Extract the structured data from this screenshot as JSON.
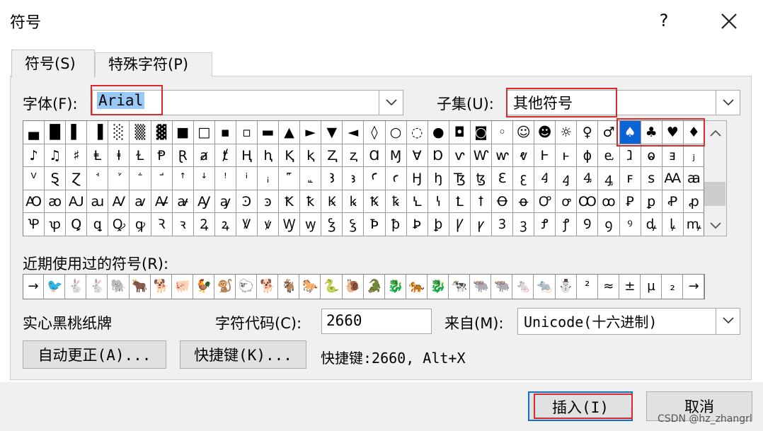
{
  "window": {
    "title": "符号",
    "help_glyph": "?"
  },
  "tabs": [
    {
      "label": "符号(S)"
    },
    {
      "label": "特殊字符(P)"
    }
  ],
  "font": {
    "label": "字体(F):",
    "value": "Arial"
  },
  "subset": {
    "label": "子集(U):",
    "value": "其他符号"
  },
  "grid_rows": [
    [
      "▄",
      "█",
      "▌",
      "▐",
      "░",
      "▒",
      "▓",
      "■",
      "□",
      "▪",
      "▫",
      "▬",
      "▲",
      "►",
      "▼",
      "◄",
      "◊",
      "○",
      "◌",
      "●",
      "◘",
      "◙",
      "◦",
      "☺",
      "☻",
      "☼",
      "♀",
      "♂",
      "♠",
      "♣",
      "♥",
      "♦"
    ],
    [
      "♪",
      "♫",
      "♯",
      "Ⱡ",
      "ⱡ",
      "Ɫ",
      "Ᵽ",
      "Ɽ",
      "ⱥ",
      "ⱦ",
      "Ⱨ",
      "ⱨ",
      "Ⱪ",
      "ⱪ",
      "Ⱬ",
      "ⱬ",
      "Ɑ",
      "Ɱ",
      "Ɐ",
      "Ɒ",
      "ⱱ",
      "Ⱳ",
      "ⱳ",
      "ⱴ",
      "Ⱶ",
      "ⱶ",
      "ɸ",
      "ⱸ",
      "ⱹ",
      "ⱺ",
      "ⱻ",
      "ⱼ"
    ],
    [
      "ⱽ",
      "Ȿ",
      "Ɀ",
      "ꜗ",
      "ꜘ",
      "ꜙ",
      "ꜚ",
      "ꜛ",
      "ꜜ",
      "ꜝ",
      "ꜞ",
      "ꜟ",
      "꜠",
      "꜡",
      "Ꜣ",
      "ꜣ",
      "Ꜥ",
      "ꜥ",
      "Ꜧ",
      "ꜧ",
      "Ꜩ",
      "ꜩ",
      "Ꜫ",
      "ꜫ",
      "Ꜭ",
      "ꜭ",
      "Ꜯ",
      "ꜯ",
      "ꜰ",
      "ꜱ",
      "Ꜳ",
      "ꜳ"
    ],
    [
      "Ꜵ",
      "ꜵ",
      "Ꜷ",
      "ꜷ",
      "Ꜹ",
      "ꜹ",
      "Ꜻ",
      "ꜻ",
      "Ꜽ",
      "ꜽ",
      "Ꜿ",
      "ꜿ",
      "Ꝁ",
      "ꝁ",
      "Ꝃ",
      "ꝃ",
      "Ꝅ",
      "ꝅ",
      "Ꝇ",
      "ꝇ",
      "Ꝉ",
      "ꝉ",
      "Ꝋ",
      "ꝋ",
      "Ꝍ",
      "ꝍ",
      "Ꝏ",
      "ꝏ",
      "Ꝑ",
      "ꝑ",
      "Ꝓ",
      "ꝓ"
    ],
    [
      "Ꝕ",
      "ꝕ",
      "Ꝗ",
      "ꝗ",
      "Ꝙ",
      "ꝙ",
      "Ꝛ",
      "ꝛ",
      "Ꝝ",
      "ꝝ",
      "Ꝟ",
      "ꝟ",
      "Ꝡ",
      "ꝡ",
      "Ꝣ",
      "ꝣ",
      "Ꝥ",
      "ꝥ",
      "Ꝧ",
      "ꝧ",
      "Ꝩ",
      "ꝩ",
      "Ꝫ",
      "ꝫ",
      "Ꝭ",
      "ꝭ",
      "Ꝯ",
      "ꝯ",
      "ꝰ",
      "ꝱ",
      "ꝲ",
      "ꝳ"
    ]
  ],
  "recent": {
    "label": "近期使用过的符号(R):",
    "items": [
      "→",
      "🐦",
      "🐇",
      "🐇",
      "🐘",
      "🐂",
      "🐕",
      "🐖",
      "🐓",
      "🐒",
      "🐑",
      "🐕",
      "🐐",
      "🐎",
      "🐍",
      "🐌",
      "🐊",
      "🐉",
      "🐅",
      "🐉",
      "🐄",
      "🐃",
      "🐃",
      "🐁",
      "🐀",
      "⛄",
      "²",
      "≈",
      "±",
      "µ",
      "₂",
      "→"
    ]
  },
  "char_name": "实心黑桃纸牌",
  "char_code": {
    "label": "字符代码(C):",
    "value": "2660"
  },
  "from": {
    "label": "来自(M):",
    "value": "Unicode(十六进制)"
  },
  "buttons": {
    "autocorrect": "自动更正(A)...",
    "shortcut_key": "快捷键(K)...",
    "insert": "插入(I)",
    "cancel": "取消"
  },
  "shortcut_text": "快捷键:2660, Alt+X",
  "watermark": "CSDN @hz_zhangrl"
}
